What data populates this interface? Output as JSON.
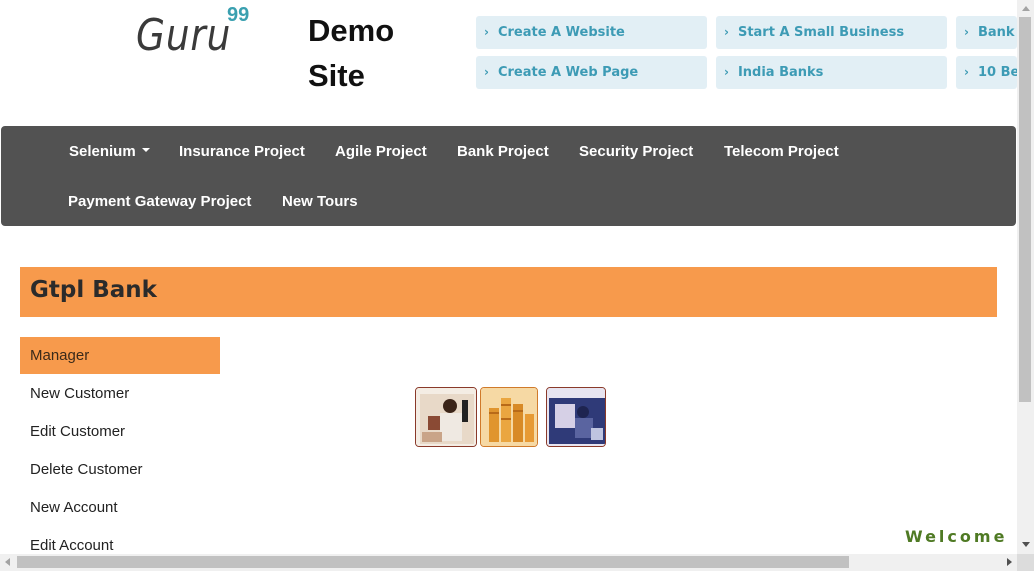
{
  "logo": {
    "word": "Guru",
    "number": "99"
  },
  "site_title": "Demo Site",
  "ad_links": [
    {
      "label": "Create A Website"
    },
    {
      "label": "Start A Small Business"
    },
    {
      "label": "Bank"
    },
    {
      "label": "Create A Web Page"
    },
    {
      "label": "India Banks"
    },
    {
      "label": "10 Be"
    }
  ],
  "navbar": {
    "items": [
      {
        "label": "Selenium"
      },
      {
        "label": "Insurance Project"
      },
      {
        "label": "Agile Project"
      },
      {
        "label": "Bank Project"
      },
      {
        "label": "Security Project"
      },
      {
        "label": "Telecom Project"
      },
      {
        "label": "Payment Gateway Project"
      },
      {
        "label": "New Tours"
      }
    ]
  },
  "bank": {
    "title": "Gtpl Bank"
  },
  "menu": {
    "items": [
      {
        "label": "Manager"
      },
      {
        "label": "New Customer"
      },
      {
        "label": "Edit Customer"
      },
      {
        "label": "Delete Customer"
      },
      {
        "label": "New Account"
      },
      {
        "label": "Edit Account"
      }
    ]
  },
  "marquee": {
    "text": "Welcome"
  },
  "colors": {
    "accent": "#f79a4c",
    "navbar": "#525252",
    "ad_bg": "#e2eff5",
    "ad_text": "#3d9bb5",
    "welcome": "#4f7a24"
  }
}
